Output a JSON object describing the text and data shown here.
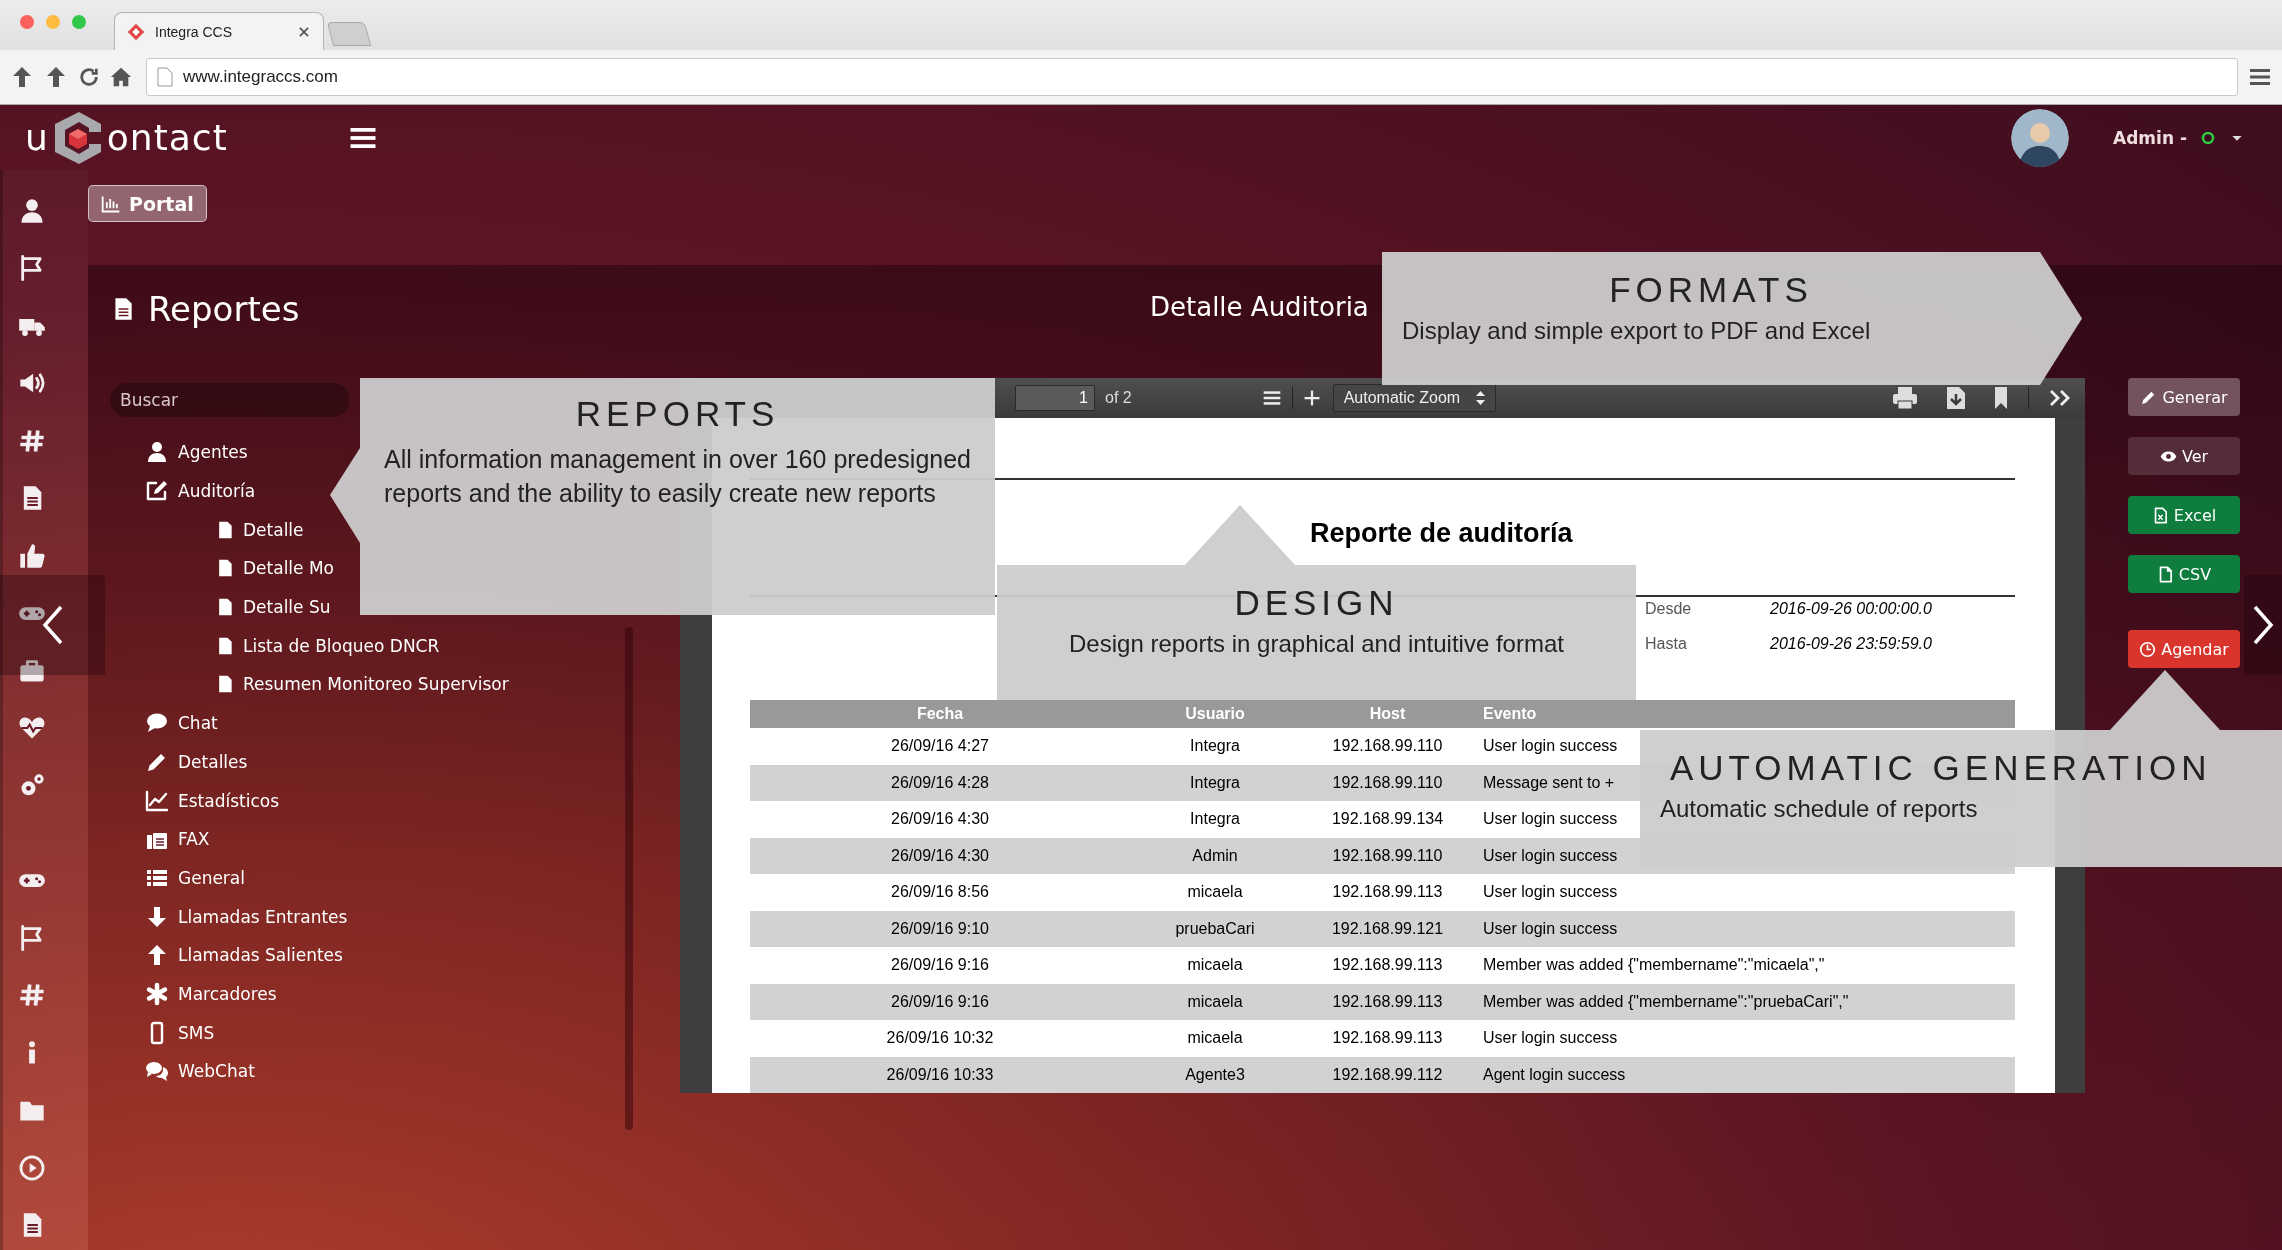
{
  "browser": {
    "tab_title": "Integra CCS",
    "url": "www.integraccs.com"
  },
  "header": {
    "logo_prefix": "u",
    "logo_suffix": "ontact",
    "user": "Admin -",
    "online": true
  },
  "portal_button": "Portal",
  "reports_panel": {
    "title": "Reportes",
    "search": {
      "placeholder": "Buscar"
    },
    "tree": [
      {
        "label": "Agentes"
      },
      {
        "label": "Auditoría",
        "children": [
          {
            "label": "Detalle"
          },
          {
            "label": "Detalle Mo"
          },
          {
            "label": "Detalle Su"
          },
          {
            "label": "Lista de Bloqueo DNCR"
          },
          {
            "label": "Resumen Monitoreo Supervisor"
          }
        ]
      },
      {
        "label": "Chat"
      },
      {
        "label": "Detalles"
      },
      {
        "label": "Estadísticos"
      },
      {
        "label": "FAX"
      },
      {
        "label": "General"
      },
      {
        "label": "Llamadas Entrantes"
      },
      {
        "label": "Llamadas Salientes"
      },
      {
        "label": "Marcadores"
      },
      {
        "label": "SMS"
      },
      {
        "label": "WebChat"
      }
    ]
  },
  "report": {
    "title": "Detalle Auditoria",
    "viewer": {
      "page": "1",
      "page_count": "of 2",
      "zoom": "Automatic Zoom"
    },
    "document": {
      "title": "Reporte de auditoría",
      "from_label": "Desde",
      "from": "2016-09-26 00:00:00.0",
      "to_label": "Hasta",
      "to": "2016-09-26 23:59:59.0",
      "columns": [
        "Fecha",
        "Usuario",
        "Host",
        "Evento"
      ],
      "rows": [
        [
          "26/09/16 4:27",
          "Integra",
          "192.168.99.110",
          "User login success"
        ],
        [
          "26/09/16 4:28",
          "Integra",
          "192.168.99.110",
          "Message sent to +"
        ],
        [
          "26/09/16 4:30",
          "Integra",
          "192.168.99.134",
          "User login success"
        ],
        [
          "26/09/16 4:30",
          "Admin",
          "192.168.99.110",
          "User login success"
        ],
        [
          "26/09/16 8:56",
          "micaela",
          "192.168.99.113",
          "User login success"
        ],
        [
          "26/09/16 9:10",
          "pruebaCari",
          "192.168.99.121",
          "User login success"
        ],
        [
          "26/09/16 9:16",
          "micaela",
          "192.168.99.113",
          "Member was added {\"membername\":\"micaela\",\""
        ],
        [
          "26/09/16 9:16",
          "micaela",
          "192.168.99.113",
          "Member was added {\"membername\":\"pruebaCari\",\""
        ],
        [
          "26/09/16 10:32",
          "micaela",
          "192.168.99.113",
          "User login success"
        ],
        [
          "26/09/16 10:33",
          "Agente3",
          "192.168.99.112",
          "Agent login success"
        ]
      ]
    }
  },
  "actions": [
    {
      "label": "Generar",
      "kind": "light"
    },
    {
      "label": "Ver",
      "kind": "dark"
    },
    {
      "label": "Excel",
      "kind": "success"
    },
    {
      "label": "CSV",
      "kind": "success"
    },
    {
      "label": "Agendar",
      "kind": "danger"
    }
  ],
  "callouts": [
    {
      "title": "FORMATS",
      "text": "Display and simple export to PDF and Excel",
      "kind": "right"
    },
    {
      "title": "REPORTS",
      "text": "All information management in over 160 predesigned reports and the ability to easily create new reports",
      "kind": "left"
    },
    {
      "title": "DESIGN",
      "text": "Design reports in graphical and intuitive format",
      "kind": "up"
    },
    {
      "title": "AUTOMATIC GENERATION",
      "text": "Automatic schedule of reports",
      "kind": "up"
    }
  ]
}
